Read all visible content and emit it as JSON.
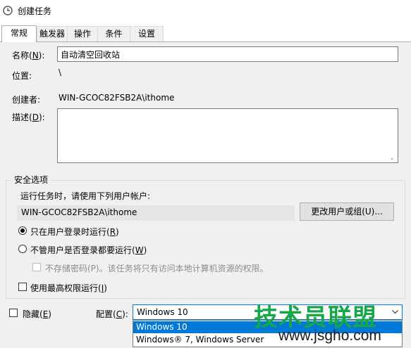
{
  "window": {
    "title": "创建任务"
  },
  "tabs": [
    {
      "label": "常规"
    },
    {
      "label": "触发器"
    },
    {
      "label": "操作"
    },
    {
      "label": "条件"
    },
    {
      "label": "设置"
    }
  ],
  "general": {
    "name_label": "名称(N):",
    "name_label_pre": "名称(",
    "name_label_key": "N",
    "name_label_post": "):",
    "name_value": "自动清空回收站",
    "location_label": "位置:",
    "location_value": "\\",
    "author_label": "创建者:",
    "author_value": "WIN-GCOC82FSB2A\\ithome",
    "desc_label_pre": "描述(",
    "desc_label_key": "D",
    "desc_label_post": "):",
    "desc_value": ""
  },
  "security": {
    "group_title": "安全选项",
    "run_as_prompt": "运行任务时，请使用下列用户帐户:",
    "account": "WIN-GCOC82FSB2A\\ithome",
    "change_user_button": "更改用户或组(U)...",
    "radio_logged_on_pre": "只在用户登录时运行(",
    "radio_logged_on_key": "R",
    "radio_logged_on_post": ")",
    "radio_whether_pre": "不管用户是否登录都要运行(",
    "radio_whether_key": "W",
    "radio_whether_post": ")",
    "no_store_password": "不存储密码(P)。该任务将只有访问本地计算机资源的权限。",
    "highest_priv_pre": "使用最高权限运行(",
    "highest_priv_key": "I",
    "highest_priv_post": ")"
  },
  "bottom": {
    "hidden_pre": "隐藏(",
    "hidden_key": "E",
    "hidden_post": ")",
    "config_pre": "配置(",
    "config_key": "C",
    "config_post": "):",
    "config_selected": "Windows 10",
    "config_options": [
      "Windows 10",
      "Windows® 7, Windows Server"
    ]
  },
  "watermark": {
    "main": "技术员联盟",
    "url": "www.jsgho.com"
  },
  "colors": {
    "accent": "#0078d7",
    "panel": "#f0f0f0",
    "watermark_green": "#14a84a"
  }
}
